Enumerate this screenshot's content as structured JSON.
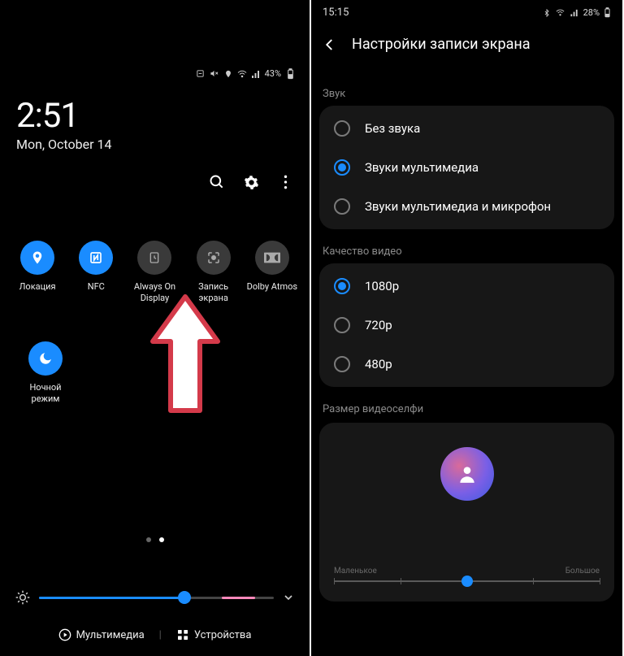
{
  "left": {
    "status": {
      "battery_pct": "43%"
    },
    "clock": "2:51",
    "date": "Mon, October 14",
    "tiles": [
      {
        "label": "Локация",
        "icon": "location-icon",
        "on": true
      },
      {
        "label": "NFC",
        "icon": "nfc-icon",
        "on": true
      },
      {
        "label": "Always On Display",
        "icon": "aod-icon",
        "on": false
      },
      {
        "label": "Запись экрана",
        "icon": "screen-record-icon",
        "on": false
      },
      {
        "label": "Dolby Atmos",
        "icon": "dolby-icon",
        "on": false
      },
      {
        "label": "Ночной режим",
        "icon": "night-mode-icon",
        "on": true
      }
    ],
    "brightness_pct": 62,
    "bottom": {
      "media": "Мультимедиа",
      "devices": "Устройства"
    }
  },
  "right": {
    "status": {
      "time": "15:15",
      "battery_pct": "28%"
    },
    "title": "Настройки записи экрана",
    "sections": {
      "sound": {
        "label": "Звук",
        "options": [
          {
            "label": "Без звука",
            "checked": false
          },
          {
            "label": "Звуки мультимедиа",
            "checked": true
          },
          {
            "label": "Звуки мультимедиа и микрофон",
            "checked": false
          }
        ]
      },
      "quality": {
        "label": "Качество видео",
        "options": [
          {
            "label": "1080p",
            "checked": true
          },
          {
            "label": "720p",
            "checked": false
          },
          {
            "label": "480p",
            "checked": false
          }
        ]
      },
      "selfie": {
        "label": "Размер видеоселфи",
        "slider": {
          "min_label": "Маленькое",
          "max_label": "Большое",
          "value_pct": 50
        }
      }
    }
  }
}
